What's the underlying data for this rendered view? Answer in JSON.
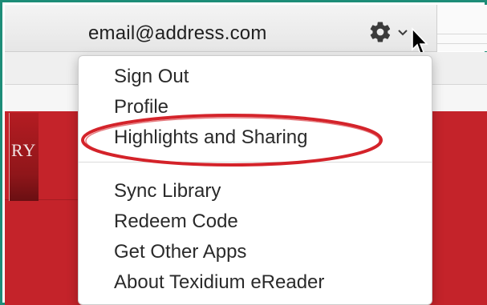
{
  "header": {
    "account_email": "email@address.com",
    "settings_icon": "gear-icon",
    "dropdown_icon": "chevron-down-icon"
  },
  "menu": {
    "group1": [
      "Sign Out",
      "Profile",
      "Highlights and Sharing"
    ],
    "group2": [
      "Sync Library",
      "Redeem Code",
      "Get Other Apps",
      "About Texidium eReader"
    ]
  },
  "background": {
    "book_cover_text": "RY"
  },
  "annotation": {
    "highlighted_item": "Highlights and Sharing",
    "color": "#d4232a"
  },
  "colors": {
    "frame_border": "#1d8d78",
    "red_panel": "#c4232a"
  }
}
